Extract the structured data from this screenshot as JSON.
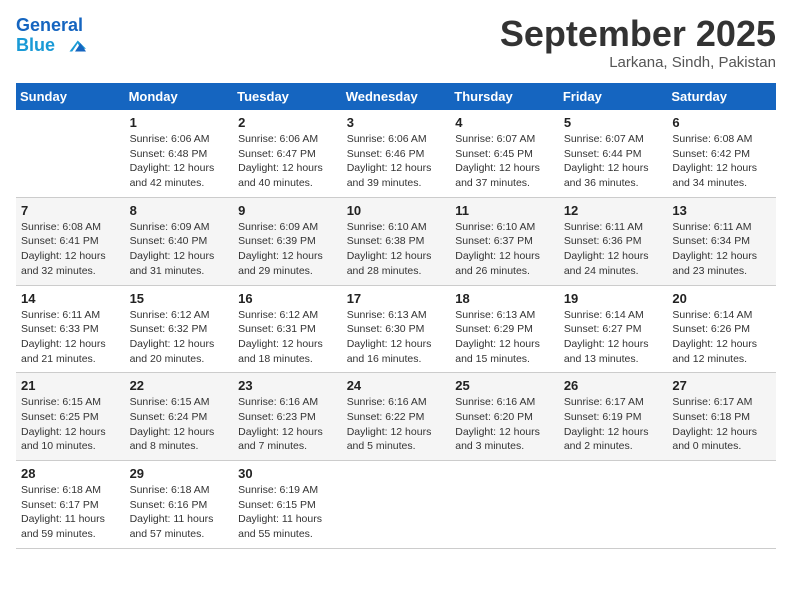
{
  "header": {
    "logo_line1": "General",
    "logo_line2": "Blue",
    "month_year": "September 2025",
    "location": "Larkana, Sindh, Pakistan"
  },
  "weekdays": [
    "Sunday",
    "Monday",
    "Tuesday",
    "Wednesday",
    "Thursday",
    "Friday",
    "Saturday"
  ],
  "weeks": [
    [
      {
        "day": "",
        "detail": ""
      },
      {
        "day": "1",
        "detail": "Sunrise: 6:06 AM\nSunset: 6:48 PM\nDaylight: 12 hours\nand 42 minutes."
      },
      {
        "day": "2",
        "detail": "Sunrise: 6:06 AM\nSunset: 6:47 PM\nDaylight: 12 hours\nand 40 minutes."
      },
      {
        "day": "3",
        "detail": "Sunrise: 6:06 AM\nSunset: 6:46 PM\nDaylight: 12 hours\nand 39 minutes."
      },
      {
        "day": "4",
        "detail": "Sunrise: 6:07 AM\nSunset: 6:45 PM\nDaylight: 12 hours\nand 37 minutes."
      },
      {
        "day": "5",
        "detail": "Sunrise: 6:07 AM\nSunset: 6:44 PM\nDaylight: 12 hours\nand 36 minutes."
      },
      {
        "day": "6",
        "detail": "Sunrise: 6:08 AM\nSunset: 6:42 PM\nDaylight: 12 hours\nand 34 minutes."
      }
    ],
    [
      {
        "day": "7",
        "detail": "Sunrise: 6:08 AM\nSunset: 6:41 PM\nDaylight: 12 hours\nand 32 minutes."
      },
      {
        "day": "8",
        "detail": "Sunrise: 6:09 AM\nSunset: 6:40 PM\nDaylight: 12 hours\nand 31 minutes."
      },
      {
        "day": "9",
        "detail": "Sunrise: 6:09 AM\nSunset: 6:39 PM\nDaylight: 12 hours\nand 29 minutes."
      },
      {
        "day": "10",
        "detail": "Sunrise: 6:10 AM\nSunset: 6:38 PM\nDaylight: 12 hours\nand 28 minutes."
      },
      {
        "day": "11",
        "detail": "Sunrise: 6:10 AM\nSunset: 6:37 PM\nDaylight: 12 hours\nand 26 minutes."
      },
      {
        "day": "12",
        "detail": "Sunrise: 6:11 AM\nSunset: 6:36 PM\nDaylight: 12 hours\nand 24 minutes."
      },
      {
        "day": "13",
        "detail": "Sunrise: 6:11 AM\nSunset: 6:34 PM\nDaylight: 12 hours\nand 23 minutes."
      }
    ],
    [
      {
        "day": "14",
        "detail": "Sunrise: 6:11 AM\nSunset: 6:33 PM\nDaylight: 12 hours\nand 21 minutes."
      },
      {
        "day": "15",
        "detail": "Sunrise: 6:12 AM\nSunset: 6:32 PM\nDaylight: 12 hours\nand 20 minutes."
      },
      {
        "day": "16",
        "detail": "Sunrise: 6:12 AM\nSunset: 6:31 PM\nDaylight: 12 hours\nand 18 minutes."
      },
      {
        "day": "17",
        "detail": "Sunrise: 6:13 AM\nSunset: 6:30 PM\nDaylight: 12 hours\nand 16 minutes."
      },
      {
        "day": "18",
        "detail": "Sunrise: 6:13 AM\nSunset: 6:29 PM\nDaylight: 12 hours\nand 15 minutes."
      },
      {
        "day": "19",
        "detail": "Sunrise: 6:14 AM\nSunset: 6:27 PM\nDaylight: 12 hours\nand 13 minutes."
      },
      {
        "day": "20",
        "detail": "Sunrise: 6:14 AM\nSunset: 6:26 PM\nDaylight: 12 hours\nand 12 minutes."
      }
    ],
    [
      {
        "day": "21",
        "detail": "Sunrise: 6:15 AM\nSunset: 6:25 PM\nDaylight: 12 hours\nand 10 minutes."
      },
      {
        "day": "22",
        "detail": "Sunrise: 6:15 AM\nSunset: 6:24 PM\nDaylight: 12 hours\nand 8 minutes."
      },
      {
        "day": "23",
        "detail": "Sunrise: 6:16 AM\nSunset: 6:23 PM\nDaylight: 12 hours\nand 7 minutes."
      },
      {
        "day": "24",
        "detail": "Sunrise: 6:16 AM\nSunset: 6:22 PM\nDaylight: 12 hours\nand 5 minutes."
      },
      {
        "day": "25",
        "detail": "Sunrise: 6:16 AM\nSunset: 6:20 PM\nDaylight: 12 hours\nand 3 minutes."
      },
      {
        "day": "26",
        "detail": "Sunrise: 6:17 AM\nSunset: 6:19 PM\nDaylight: 12 hours\nand 2 minutes."
      },
      {
        "day": "27",
        "detail": "Sunrise: 6:17 AM\nSunset: 6:18 PM\nDaylight: 12 hours\nand 0 minutes."
      }
    ],
    [
      {
        "day": "28",
        "detail": "Sunrise: 6:18 AM\nSunset: 6:17 PM\nDaylight: 11 hours\nand 59 minutes."
      },
      {
        "day": "29",
        "detail": "Sunrise: 6:18 AM\nSunset: 6:16 PM\nDaylight: 11 hours\nand 57 minutes."
      },
      {
        "day": "30",
        "detail": "Sunrise: 6:19 AM\nSunset: 6:15 PM\nDaylight: 11 hours\nand 55 minutes."
      },
      {
        "day": "",
        "detail": ""
      },
      {
        "day": "",
        "detail": ""
      },
      {
        "day": "",
        "detail": ""
      },
      {
        "day": "",
        "detail": ""
      }
    ]
  ]
}
